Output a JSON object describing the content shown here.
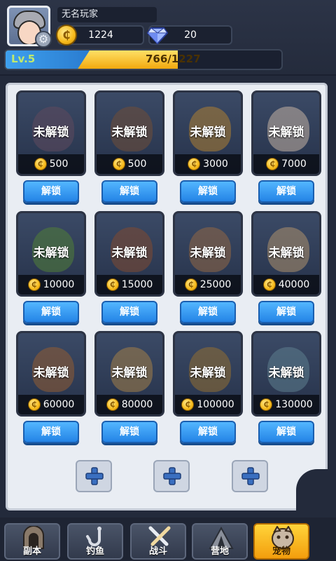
{
  "player": {
    "name": "无名玩家",
    "gold": "1224",
    "gems": "20",
    "level_label": "Lv.5",
    "exp_text": "766/1227",
    "exp_progress": 0.624
  },
  "colors": {
    "accent_blue": "#2484e6",
    "gold": "#f6b91a",
    "active_tab": "#ffd43a"
  },
  "pets": [
    {
      "status": "未解锁",
      "price": "500",
      "button": "解锁",
      "tone": "#5b4a5e"
    },
    {
      "status": "未解锁",
      "price": "500",
      "button": "解锁",
      "tone": "#6b4d3a"
    },
    {
      "status": "未解锁",
      "price": "3000",
      "button": "解锁",
      "tone": "#a37a35"
    },
    {
      "status": "未解锁",
      "price": "7000",
      "button": "解锁",
      "tone": "#b7a99d"
    },
    {
      "status": "未解锁",
      "price": "10000",
      "button": "解锁",
      "tone": "#4f7a3a"
    },
    {
      "status": "未解锁",
      "price": "15000",
      "button": "解锁",
      "tone": "#7a4a34"
    },
    {
      "status": "未解锁",
      "price": "25000",
      "button": "解锁",
      "tone": "#8a6446"
    },
    {
      "status": "未解锁",
      "price": "40000",
      "button": "解锁",
      "tone": "#a38a6a"
    },
    {
      "status": "未解锁",
      "price": "60000",
      "button": "解锁",
      "tone": "#8a5a35"
    },
    {
      "status": "未解锁",
      "price": "80000",
      "button": "解锁",
      "tone": "#9a7a4a"
    },
    {
      "status": "未解锁",
      "price": "100000",
      "button": "解锁",
      "tone": "#8a6a35"
    },
    {
      "status": "未解锁",
      "price": "130000",
      "button": "解锁",
      "tone": "#5a7a8a"
    }
  ],
  "add_slots": 3,
  "nav": {
    "items": [
      {
        "label": "副本",
        "icon": "dungeon-gate-icon"
      },
      {
        "label": "钓鱼",
        "icon": "fishing-hook-icon"
      },
      {
        "label": "战斗",
        "icon": "crossed-swords-icon"
      },
      {
        "label": "营地",
        "icon": "tent-icon"
      },
      {
        "label": "宠物",
        "icon": "pet-face-icon"
      }
    ],
    "active_index": 4
  }
}
